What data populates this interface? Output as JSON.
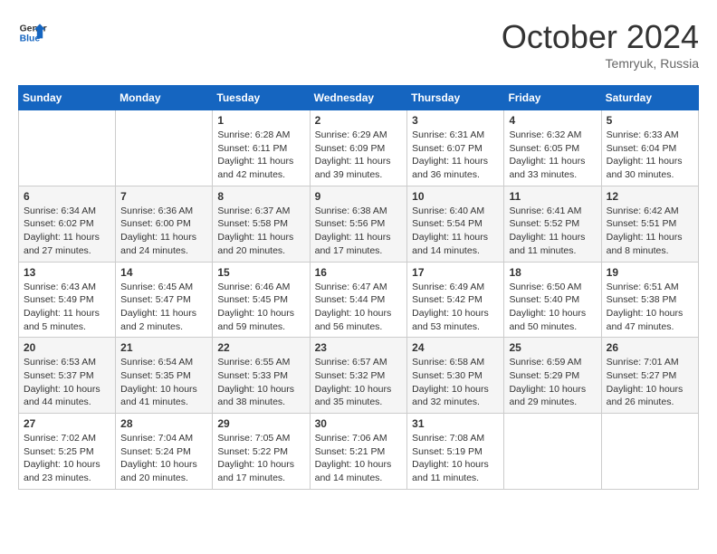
{
  "logo": {
    "line1": "General",
    "line2": "Blue"
  },
  "title": "October 2024",
  "location": "Temryuk, Russia",
  "weekdays": [
    "Sunday",
    "Monday",
    "Tuesday",
    "Wednesday",
    "Thursday",
    "Friday",
    "Saturday"
  ],
  "weeks": [
    [
      {
        "day": "",
        "content": ""
      },
      {
        "day": "",
        "content": ""
      },
      {
        "day": "1",
        "content": "Sunrise: 6:28 AM\nSunset: 6:11 PM\nDaylight: 11 hours and 42 minutes."
      },
      {
        "day": "2",
        "content": "Sunrise: 6:29 AM\nSunset: 6:09 PM\nDaylight: 11 hours and 39 minutes."
      },
      {
        "day": "3",
        "content": "Sunrise: 6:31 AM\nSunset: 6:07 PM\nDaylight: 11 hours and 36 minutes."
      },
      {
        "day": "4",
        "content": "Sunrise: 6:32 AM\nSunset: 6:05 PM\nDaylight: 11 hours and 33 minutes."
      },
      {
        "day": "5",
        "content": "Sunrise: 6:33 AM\nSunset: 6:04 PM\nDaylight: 11 hours and 30 minutes."
      }
    ],
    [
      {
        "day": "6",
        "content": "Sunrise: 6:34 AM\nSunset: 6:02 PM\nDaylight: 11 hours and 27 minutes."
      },
      {
        "day": "7",
        "content": "Sunrise: 6:36 AM\nSunset: 6:00 PM\nDaylight: 11 hours and 24 minutes."
      },
      {
        "day": "8",
        "content": "Sunrise: 6:37 AM\nSunset: 5:58 PM\nDaylight: 11 hours and 20 minutes."
      },
      {
        "day": "9",
        "content": "Sunrise: 6:38 AM\nSunset: 5:56 PM\nDaylight: 11 hours and 17 minutes."
      },
      {
        "day": "10",
        "content": "Sunrise: 6:40 AM\nSunset: 5:54 PM\nDaylight: 11 hours and 14 minutes."
      },
      {
        "day": "11",
        "content": "Sunrise: 6:41 AM\nSunset: 5:52 PM\nDaylight: 11 hours and 11 minutes."
      },
      {
        "day": "12",
        "content": "Sunrise: 6:42 AM\nSunset: 5:51 PM\nDaylight: 11 hours and 8 minutes."
      }
    ],
    [
      {
        "day": "13",
        "content": "Sunrise: 6:43 AM\nSunset: 5:49 PM\nDaylight: 11 hours and 5 minutes."
      },
      {
        "day": "14",
        "content": "Sunrise: 6:45 AM\nSunset: 5:47 PM\nDaylight: 11 hours and 2 minutes."
      },
      {
        "day": "15",
        "content": "Sunrise: 6:46 AM\nSunset: 5:45 PM\nDaylight: 10 hours and 59 minutes."
      },
      {
        "day": "16",
        "content": "Sunrise: 6:47 AM\nSunset: 5:44 PM\nDaylight: 10 hours and 56 minutes."
      },
      {
        "day": "17",
        "content": "Sunrise: 6:49 AM\nSunset: 5:42 PM\nDaylight: 10 hours and 53 minutes."
      },
      {
        "day": "18",
        "content": "Sunrise: 6:50 AM\nSunset: 5:40 PM\nDaylight: 10 hours and 50 minutes."
      },
      {
        "day": "19",
        "content": "Sunrise: 6:51 AM\nSunset: 5:38 PM\nDaylight: 10 hours and 47 minutes."
      }
    ],
    [
      {
        "day": "20",
        "content": "Sunrise: 6:53 AM\nSunset: 5:37 PM\nDaylight: 10 hours and 44 minutes."
      },
      {
        "day": "21",
        "content": "Sunrise: 6:54 AM\nSunset: 5:35 PM\nDaylight: 10 hours and 41 minutes."
      },
      {
        "day": "22",
        "content": "Sunrise: 6:55 AM\nSunset: 5:33 PM\nDaylight: 10 hours and 38 minutes."
      },
      {
        "day": "23",
        "content": "Sunrise: 6:57 AM\nSunset: 5:32 PM\nDaylight: 10 hours and 35 minutes."
      },
      {
        "day": "24",
        "content": "Sunrise: 6:58 AM\nSunset: 5:30 PM\nDaylight: 10 hours and 32 minutes."
      },
      {
        "day": "25",
        "content": "Sunrise: 6:59 AM\nSunset: 5:29 PM\nDaylight: 10 hours and 29 minutes."
      },
      {
        "day": "26",
        "content": "Sunrise: 7:01 AM\nSunset: 5:27 PM\nDaylight: 10 hours and 26 minutes."
      }
    ],
    [
      {
        "day": "27",
        "content": "Sunrise: 7:02 AM\nSunset: 5:25 PM\nDaylight: 10 hours and 23 minutes."
      },
      {
        "day": "28",
        "content": "Sunrise: 7:04 AM\nSunset: 5:24 PM\nDaylight: 10 hours and 20 minutes."
      },
      {
        "day": "29",
        "content": "Sunrise: 7:05 AM\nSunset: 5:22 PM\nDaylight: 10 hours and 17 minutes."
      },
      {
        "day": "30",
        "content": "Sunrise: 7:06 AM\nSunset: 5:21 PM\nDaylight: 10 hours and 14 minutes."
      },
      {
        "day": "31",
        "content": "Sunrise: 7:08 AM\nSunset: 5:19 PM\nDaylight: 10 hours and 11 minutes."
      },
      {
        "day": "",
        "content": ""
      },
      {
        "day": "",
        "content": ""
      }
    ]
  ]
}
